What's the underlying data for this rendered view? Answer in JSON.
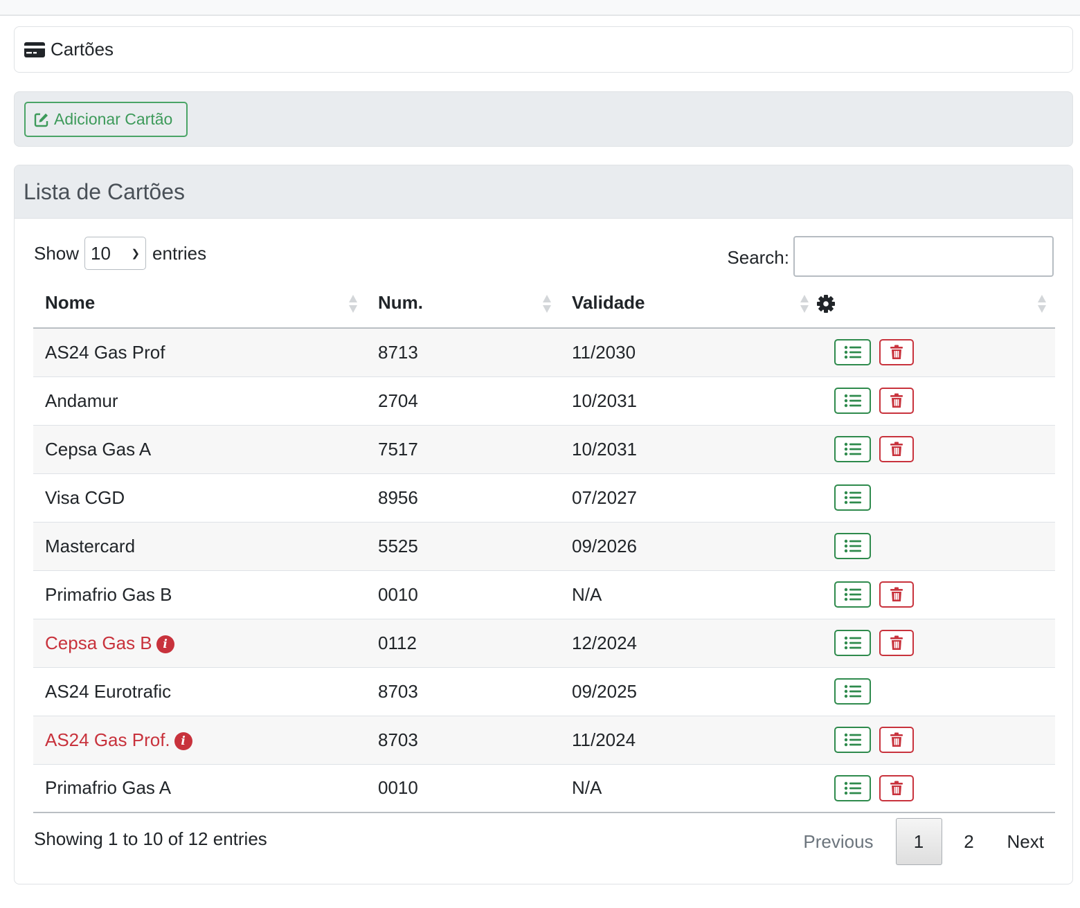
{
  "page": {
    "title": "Cartões",
    "add_button": "Adicionar Cartão"
  },
  "list": {
    "header": "Lista de Cartões",
    "show_label": "Show",
    "entries_label": "entries",
    "page_length": "10",
    "search_label": "Search:",
    "search_value": "",
    "columns": [
      "Nome",
      "Num.",
      "Validade"
    ],
    "actions_column_icon": "gear-icon",
    "rows": [
      {
        "name": "AS24 Gas Prof",
        "num": "8713",
        "validade": "11/2030",
        "warning": false,
        "deletable": true
      },
      {
        "name": "Andamur",
        "num": "2704",
        "validade": "10/2031",
        "warning": false,
        "deletable": true
      },
      {
        "name": "Cepsa Gas A",
        "num": "7517",
        "validade": "10/2031",
        "warning": false,
        "deletable": true
      },
      {
        "name": "Visa CGD",
        "num": "8956",
        "validade": "07/2027",
        "warning": false,
        "deletable": false
      },
      {
        "name": "Mastercard",
        "num": "5525",
        "validade": "09/2026",
        "warning": false,
        "deletable": false
      },
      {
        "name": "Primafrio Gas B",
        "num": "0010",
        "validade": "N/A",
        "warning": false,
        "deletable": true
      },
      {
        "name": "Cepsa Gas B",
        "num": "0112",
        "validade": "12/2024",
        "warning": true,
        "deletable": true
      },
      {
        "name": "AS24 Eurotrafic",
        "num": "8703",
        "validade": "09/2025",
        "warning": false,
        "deletable": false
      },
      {
        "name": "AS24 Gas Prof.",
        "num": "8703",
        "validade": "11/2024",
        "warning": true,
        "deletable": true
      },
      {
        "name": "Primafrio Gas A",
        "num": "0010",
        "validade": "N/A",
        "warning": false,
        "deletable": true
      }
    ],
    "info": "Showing 1 to 10 of 12 entries",
    "pagination": {
      "previous": "Previous",
      "pages": [
        "1",
        "2"
      ],
      "current": "1",
      "next": "Next"
    }
  },
  "colors": {
    "success": "#2e8a4c",
    "danger": "#c8323c",
    "header_bg": "#e9ecef"
  }
}
